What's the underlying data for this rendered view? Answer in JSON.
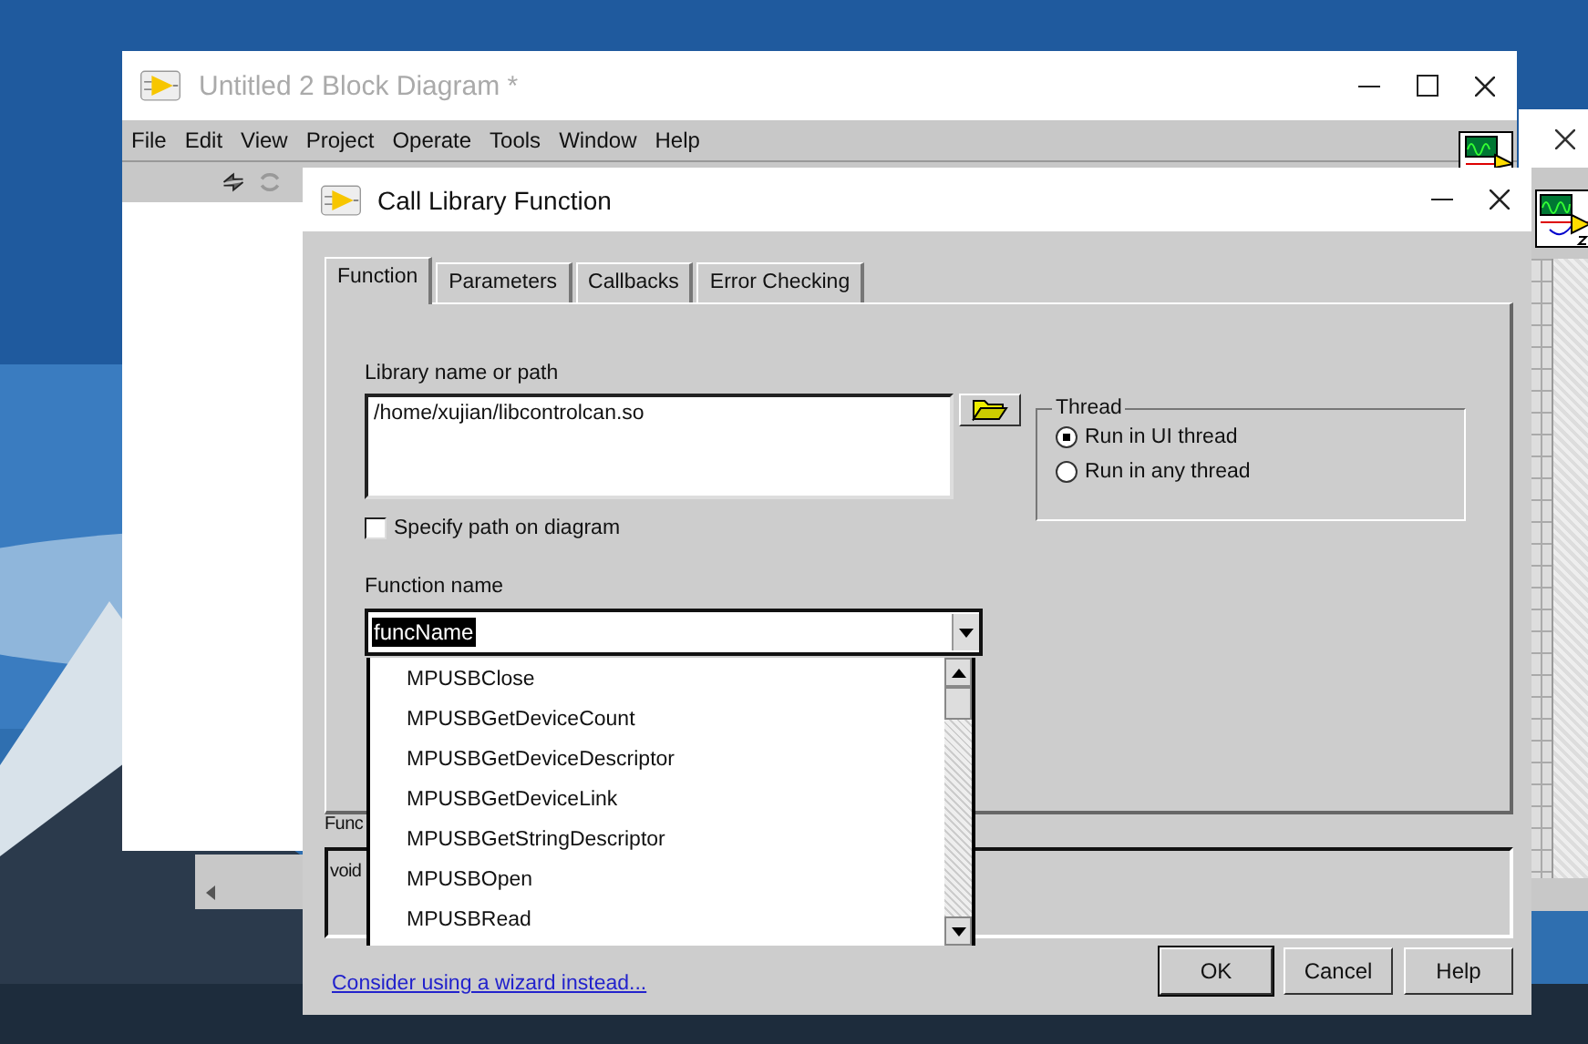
{
  "back_window": {
    "title": "Untitled 2 Block Diagram *",
    "menu": [
      "File",
      "Edit",
      "View",
      "Project",
      "Operate",
      "Tools",
      "Window",
      "Help"
    ]
  },
  "dialog": {
    "title": "Call Library Function",
    "tabs": [
      {
        "label": "Function",
        "selected": true
      },
      {
        "label": "Parameters",
        "selected": false
      },
      {
        "label": "Callbacks",
        "selected": false
      },
      {
        "label": "Error Checking",
        "selected": false
      }
    ],
    "library": {
      "label": "Library name or path",
      "value": "/home/xujian/libcontrolcan.so"
    },
    "specify_path": {
      "label": "Specify path on diagram",
      "checked": false
    },
    "function_name": {
      "label": "Function name",
      "value": "funcName",
      "options": [
        "MPUSBClose",
        "MPUSBGetDeviceCount",
        "MPUSBGetDeviceDescriptor",
        "MPUSBGetDeviceLink",
        "MPUSBGetStringDescriptor",
        "MPUSBOpen",
        "MPUSBRead"
      ]
    },
    "thread": {
      "title": "Thread",
      "options": [
        {
          "label": "Run in UI thread",
          "selected": true
        },
        {
          "label": "Run in any thread",
          "selected": false
        }
      ]
    },
    "prototype": {
      "label": "Func",
      "value": "void"
    },
    "link": "Consider using a wizard instead...",
    "buttons": [
      {
        "label": "OK",
        "default": true
      },
      {
        "label": "Cancel",
        "default": false
      },
      {
        "label": "Help",
        "default": false
      }
    ]
  }
}
